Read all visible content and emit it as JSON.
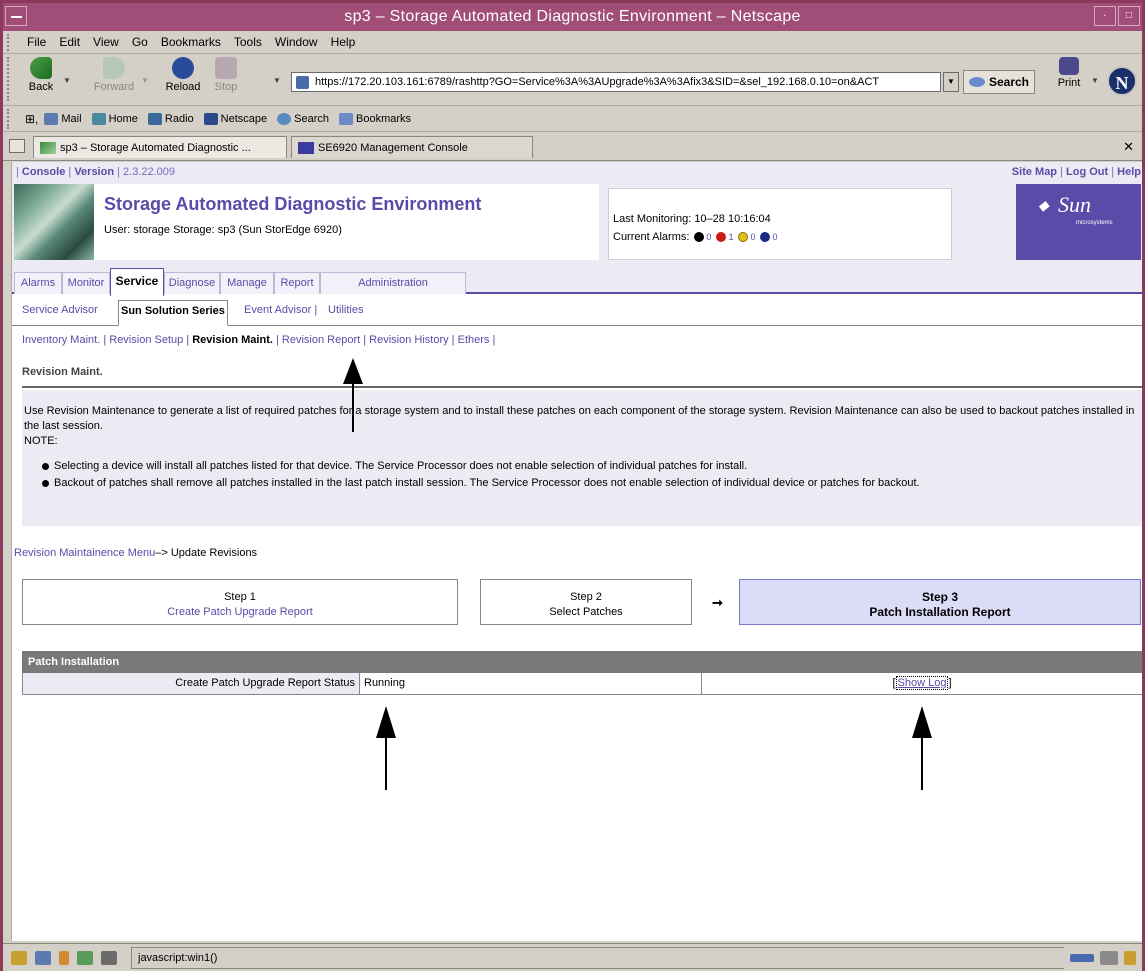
{
  "window": {
    "title": "sp3 – Storage Automated Diagnostic Environment – Netscape"
  },
  "menu": [
    "File",
    "Edit",
    "View",
    "Go",
    "Bookmarks",
    "Tools",
    "Window",
    "Help"
  ],
  "nav": {
    "back": "Back",
    "forward": "Forward",
    "reload": "Reload",
    "stop": "Stop",
    "url": "https://172.20.103.161:6789/rashttp?GO=Service%3A%3AUpgrade%3A%3Afix3&SID=&sel_192.168.0.10=on&ACT",
    "search": "Search",
    "print": "Print"
  },
  "personal": [
    "Mail",
    "Home",
    "Radio",
    "Netscape",
    "Search",
    "Bookmarks"
  ],
  "browser_tabs": [
    "sp3 – Storage Automated Diagnostic ...",
    "SE6920 Management Console"
  ],
  "masthead": {
    "console": "Console",
    "version_label": "Version",
    "version": "2.3.22.009",
    "site_map": "Site Map",
    "log_out": "Log Out",
    "help": "Help",
    "app_title": "Storage Automated Diagnostic Environment",
    "user_line": "User: storage   Storage: sp3   (Sun StorEdge 6920)",
    "last_monitoring": "Last Monitoring: 10–28 10:16:04",
    "current_alarms_label": "Current Alarms:",
    "alarms": [
      "0",
      "1",
      "0",
      "0"
    ],
    "logo_text": "Sun",
    "logo_sub": "microsystems"
  },
  "tabs_level1": [
    "Alarms",
    "Monitor",
    "Service",
    "Diagnose",
    "Manage",
    "Report",
    "Administration"
  ],
  "tabs_level2": [
    "Service Advisor",
    "Sun Solution Series",
    "Event Advisor",
    "Utilities"
  ],
  "tabs_level3": [
    "Inventory Maint.",
    "Revision Setup",
    "Revision Maint.",
    "Revision Report",
    "Revision History",
    "Ethers"
  ],
  "section_title": "Revision Maint.",
  "description": {
    "text": "Use Revision Maintenance to generate a list of required patches for a storage system and to install these patches on each component of the storage system. Revision Maintenance can also be used to backout patches installed in the last session.",
    "note": "NOTE:",
    "bullets": [
      "Selecting a device will install all patches listed for that device. The Service Processor does not enable selection of individual patches for install.",
      "Backout of patches shall remove all patches installed in the last patch install session. The Service Processor does not enable selection of individual device or patches for backout."
    ]
  },
  "breadcrumb": {
    "link": "Revision Maintainence Menu",
    "current": "–> Update Revisions"
  },
  "steps": [
    {
      "num": "Step 1",
      "label": "Create Patch Upgrade Report"
    },
    {
      "num": "Step 2",
      "label": "Select Patches"
    },
    {
      "num": "Step 3",
      "label": "Patch Installation Report"
    }
  ],
  "patch_installation": {
    "header": "Patch Installation",
    "row_label": "Create Patch Upgrade Report Status",
    "status": "Running",
    "show_log": "Show Log"
  },
  "status_bar": {
    "text": "javascript:win1()"
  }
}
